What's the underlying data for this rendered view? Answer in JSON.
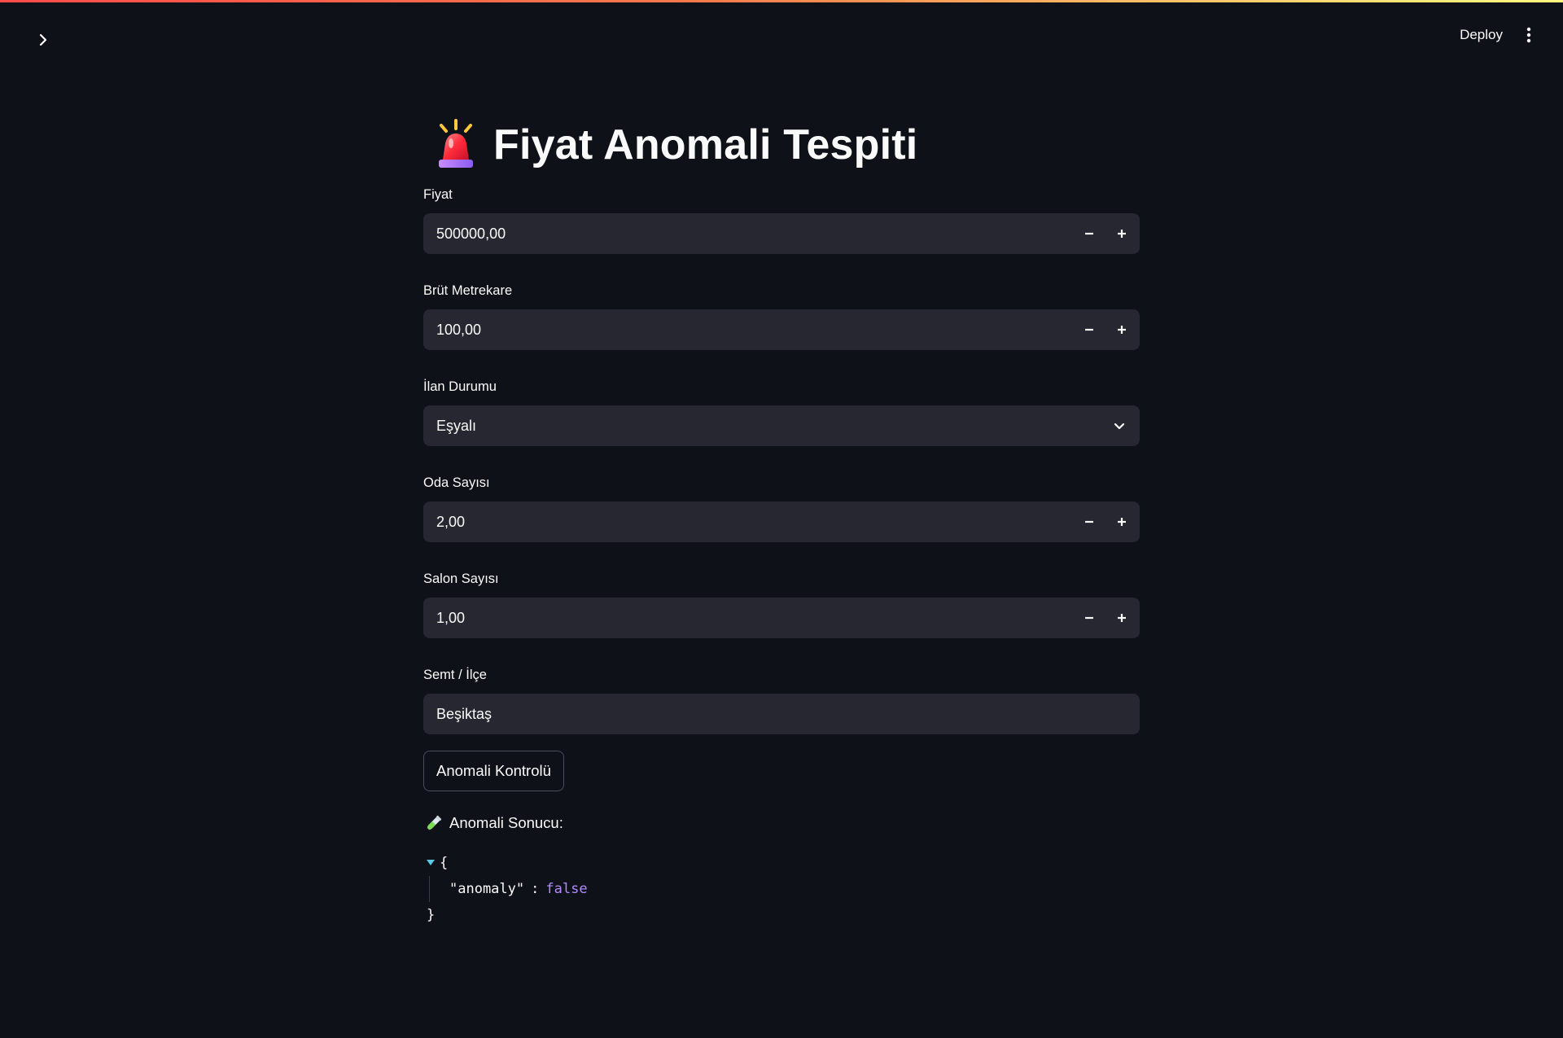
{
  "colors": {
    "background": "#0e1117",
    "input_background": "#262730",
    "text": "#fafafa",
    "accent_bar_start": "#ff4b4b",
    "accent_bar_end": "#fffd80",
    "json_bool": "#b28aff"
  },
  "header": {
    "sidebar_toggle_icon": "chevron-right-icon",
    "deploy_label": "Deploy",
    "menu_icon": "more-vertical-icon"
  },
  "main": {
    "title_icon": "police-light-icon",
    "title": "Fiyat Anomali Tespiti",
    "fields": {
      "fiyat": {
        "label": "Fiyat",
        "value": "500000,00"
      },
      "brut_metrekare": {
        "label": "Brüt Metrekare",
        "value": "100,00"
      },
      "ilan_durumu": {
        "label": "İlan Durumu",
        "value": "Eşyalı"
      },
      "oda_sayisi": {
        "label": "Oda Sayısı",
        "value": "2,00"
      },
      "salon_sayisi": {
        "label": "Salon Sayısı",
        "value": "1,00"
      },
      "semt_ilce": {
        "label": "Semt / İlçe",
        "value": "Beşiktaş"
      }
    },
    "check_button_label": "Anomali Kontrolü",
    "result": {
      "icon": "test-tube-icon",
      "label": "Anomali Sonucu:",
      "json": {
        "open_brace": "{",
        "key": "\"anomaly\"",
        "colon": ":",
        "value": "false",
        "close_brace": "}"
      }
    }
  }
}
